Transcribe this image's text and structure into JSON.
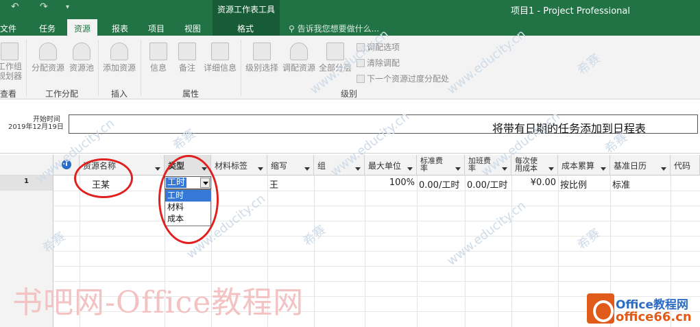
{
  "window": {
    "app_title": "项目1 - Project Professional",
    "contextual_title": "资源工作表工具"
  },
  "qat": {
    "undo": "↶",
    "redo": "↷",
    "more": "▾"
  },
  "tabs": [
    "文件",
    "任务",
    "资源",
    "报表",
    "项目",
    "视图",
    "格式"
  ],
  "active_tab": "资源",
  "tell_me": "告诉我您想要做什么...",
  "ribbon": {
    "groups": [
      {
        "label": "查看",
        "buttons": [
          "工作组\n规划器"
        ]
      },
      {
        "label": "工作分配",
        "buttons": [
          "分配资源",
          "资源池"
        ]
      },
      {
        "label": "插入",
        "buttons": [
          "添加资源"
        ]
      },
      {
        "label": "属性",
        "buttons": [
          "信息",
          "备注",
          "详细信息"
        ]
      },
      {
        "label": "级别",
        "buttons": [
          "级别选择",
          "调配资源",
          "全部分层"
        ],
        "small": [
          "调配选项",
          "清除调配",
          "下一个资源过度分配处"
        ]
      }
    ]
  },
  "timeline": {
    "start_label": "开始时间",
    "start_date": "2019年12月19日",
    "placeholder": "将带有日期的任务添加到日程表"
  },
  "table": {
    "columns": [
      "资源名称",
      "类型",
      "材料标签",
      "缩写",
      "组",
      "最大单位",
      "标准费\n率",
      "加班费\n率",
      "每次使\n用成本",
      "成本累算",
      "基准日历",
      "代码"
    ],
    "rows": [
      {
        "id": "1",
        "name": "王某",
        "type": "工时",
        "initials": "王",
        "max_units": "100%",
        "std_rate": "0.00/工时",
        "ovt_rate": "0.00/工时",
        "cost_per_use": "¥0.00",
        "accrue": "按比例",
        "calendar": "标准"
      }
    ]
  },
  "type_dropdown": {
    "options": [
      "工时",
      "材料",
      "成本"
    ],
    "selected": "工时"
  },
  "watermarks": {
    "site_text": "书吧网-Office教程网",
    "logo_line1": "Office教程网",
    "logo_line2": "office66.cn",
    "diag": [
      "希赛",
      "www.educity.cn"
    ]
  },
  "colors": {
    "ribbon_green": "#217346",
    "highlight": "#3578d6",
    "annotation_red": "#e02020"
  }
}
